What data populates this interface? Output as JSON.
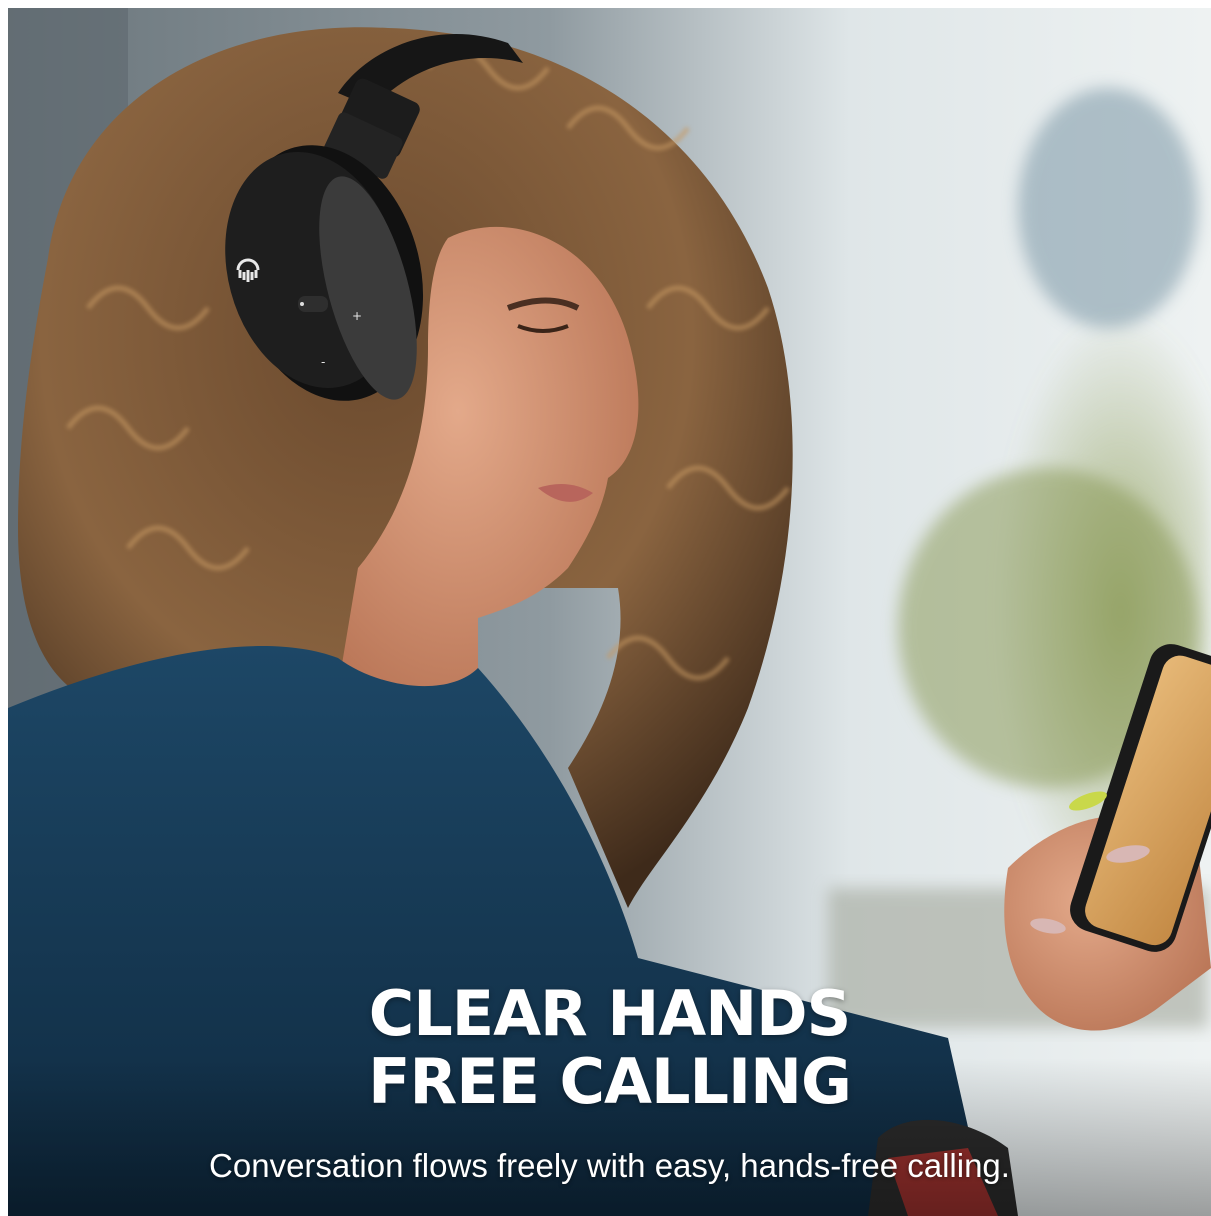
{
  "overlay": {
    "headline_line1": "CLEAR HANDS",
    "headline_line2": "FREE CALLING",
    "tagline": "Conversation flows freely with easy, hands-free calling."
  },
  "headphone_controls": {
    "plus": "+",
    "minus": "-"
  },
  "colors": {
    "text": "#ffffff",
    "sweater": "#173a55",
    "headphones": "#151515",
    "background_blur": "#c9d3d6"
  }
}
